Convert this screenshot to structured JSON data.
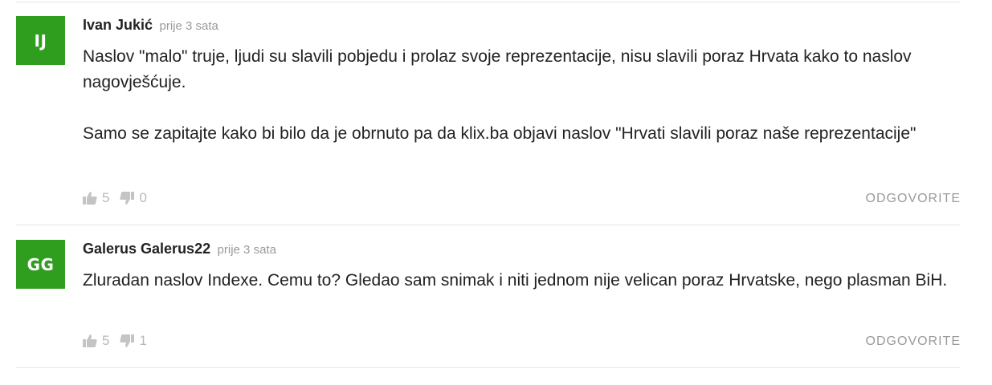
{
  "comments": [
    {
      "initials": "IJ",
      "author": "Ivan Jukić",
      "time": "prije 3 sata",
      "paragraphs": [
        "Naslov \"malo\" truje, ljudi su slavili pobjedu i prolaz svoje reprezentacije, nisu slavili poraz Hrvata kako to naslov nagovješćuje.",
        "Samo se zapitajte kako bi bilo da je obrnuto pa da klix.ba objavi naslov \"Hrvati slavili poraz naše reprezentacije\""
      ],
      "likes": "5",
      "dislikes": "0",
      "reply_label": "ODGOVORITE"
    },
    {
      "initials": "GG",
      "author": "Galerus Galerus22",
      "time": "prije 3 sata",
      "paragraphs": [
        "Zluradan naslov Indexe. Cemu to? Gledao sam snimak i niti jednom nije velican poraz Hrvatske, nego plasman BiH."
      ],
      "likes": "5",
      "dislikes": "1",
      "reply_label": "ODGOVORITE"
    }
  ],
  "colors": {
    "avatar": "#2f9e1f",
    "muted": "#9a9a9a",
    "divider": "#e6e6e6"
  },
  "icons": {
    "like": "thumbs-up-icon",
    "dislike": "thumbs-down-icon"
  }
}
